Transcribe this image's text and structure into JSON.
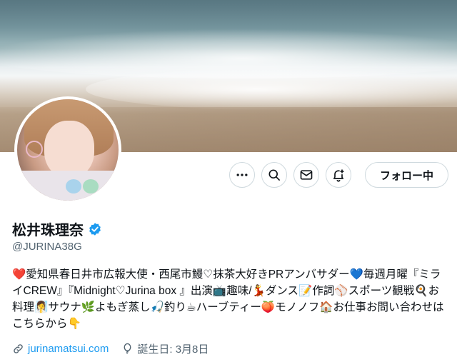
{
  "profile": {
    "name": "松井珠理奈",
    "handle": "@JURINA38G",
    "bio": "❤️愛知県春日井市広報大使・西尾市鰻♡抹茶大好きPRアンバサダー💙毎週月曜『ミライCREW』『Midnight♡Jurina box 』出演📺趣味/💃ダンス📝作詞⚾スポーツ観戦🍳お料理🧖‍♀️サウナ🌿よもぎ蒸し🎣釣り☕ハーブティー🍑モノノフ🏠お仕事お問い合わせはこちらから👇",
    "website": "jurinamatsui.com",
    "birthday": "誕生日: 3月8日"
  },
  "actions": {
    "follow_label": "フォロー中"
  },
  "icons": {
    "more": "more-dots-icon",
    "search": "search-icon",
    "message": "mail-icon",
    "notify": "bell-plus-icon",
    "verified": "verified-badge-icon",
    "link": "link-icon",
    "birthday": "balloon-icon"
  },
  "colors": {
    "accent": "#1d9bf0",
    "secondary_text": "#536471",
    "border": "#cfd9de"
  }
}
